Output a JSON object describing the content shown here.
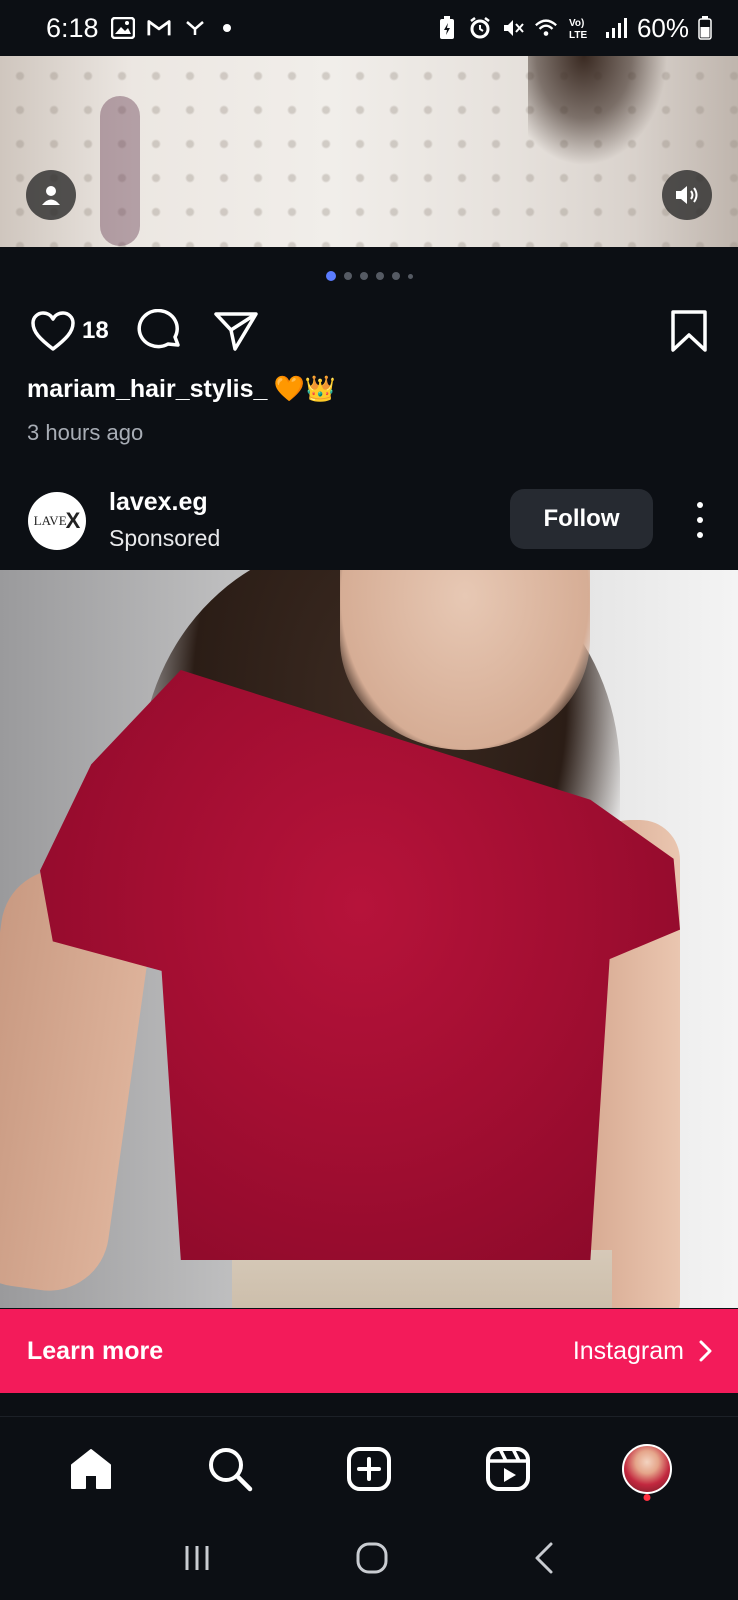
{
  "status_bar": {
    "time": "6:18",
    "battery": "60%",
    "left_icons": [
      "gallery-icon",
      "gmail-icon",
      "notification-icon"
    ],
    "right_icons": [
      "battery-saver-icon",
      "alarm-icon",
      "mute-icon",
      "wifi-icon",
      "volte-icon",
      "signal-icon",
      "battery-icon"
    ]
  },
  "previous_post": {
    "like_count": "18",
    "username": "mariam_hair_stylis_",
    "emoji": "🧡👑",
    "time_ago": "3 hours ago",
    "carousel": {
      "total_dots": 6,
      "active_index": 0
    }
  },
  "sponsored_post": {
    "avatar_text": "LAVE",
    "avatar_mark": "X",
    "username": "lavex.eg",
    "subtitle": "Sponsored",
    "follow_label": "Follow",
    "cta_label": "Learn more",
    "cta_link": "Instagram"
  },
  "bottom_nav": {
    "items": [
      "home-icon",
      "search-icon",
      "create-icon",
      "reels-icon",
      "profile-avatar"
    ]
  },
  "colors": {
    "background": "#0c0f14",
    "cta": "#f31b5a",
    "active_dot": "#5b7cff",
    "follow_button": "#262a31"
  }
}
